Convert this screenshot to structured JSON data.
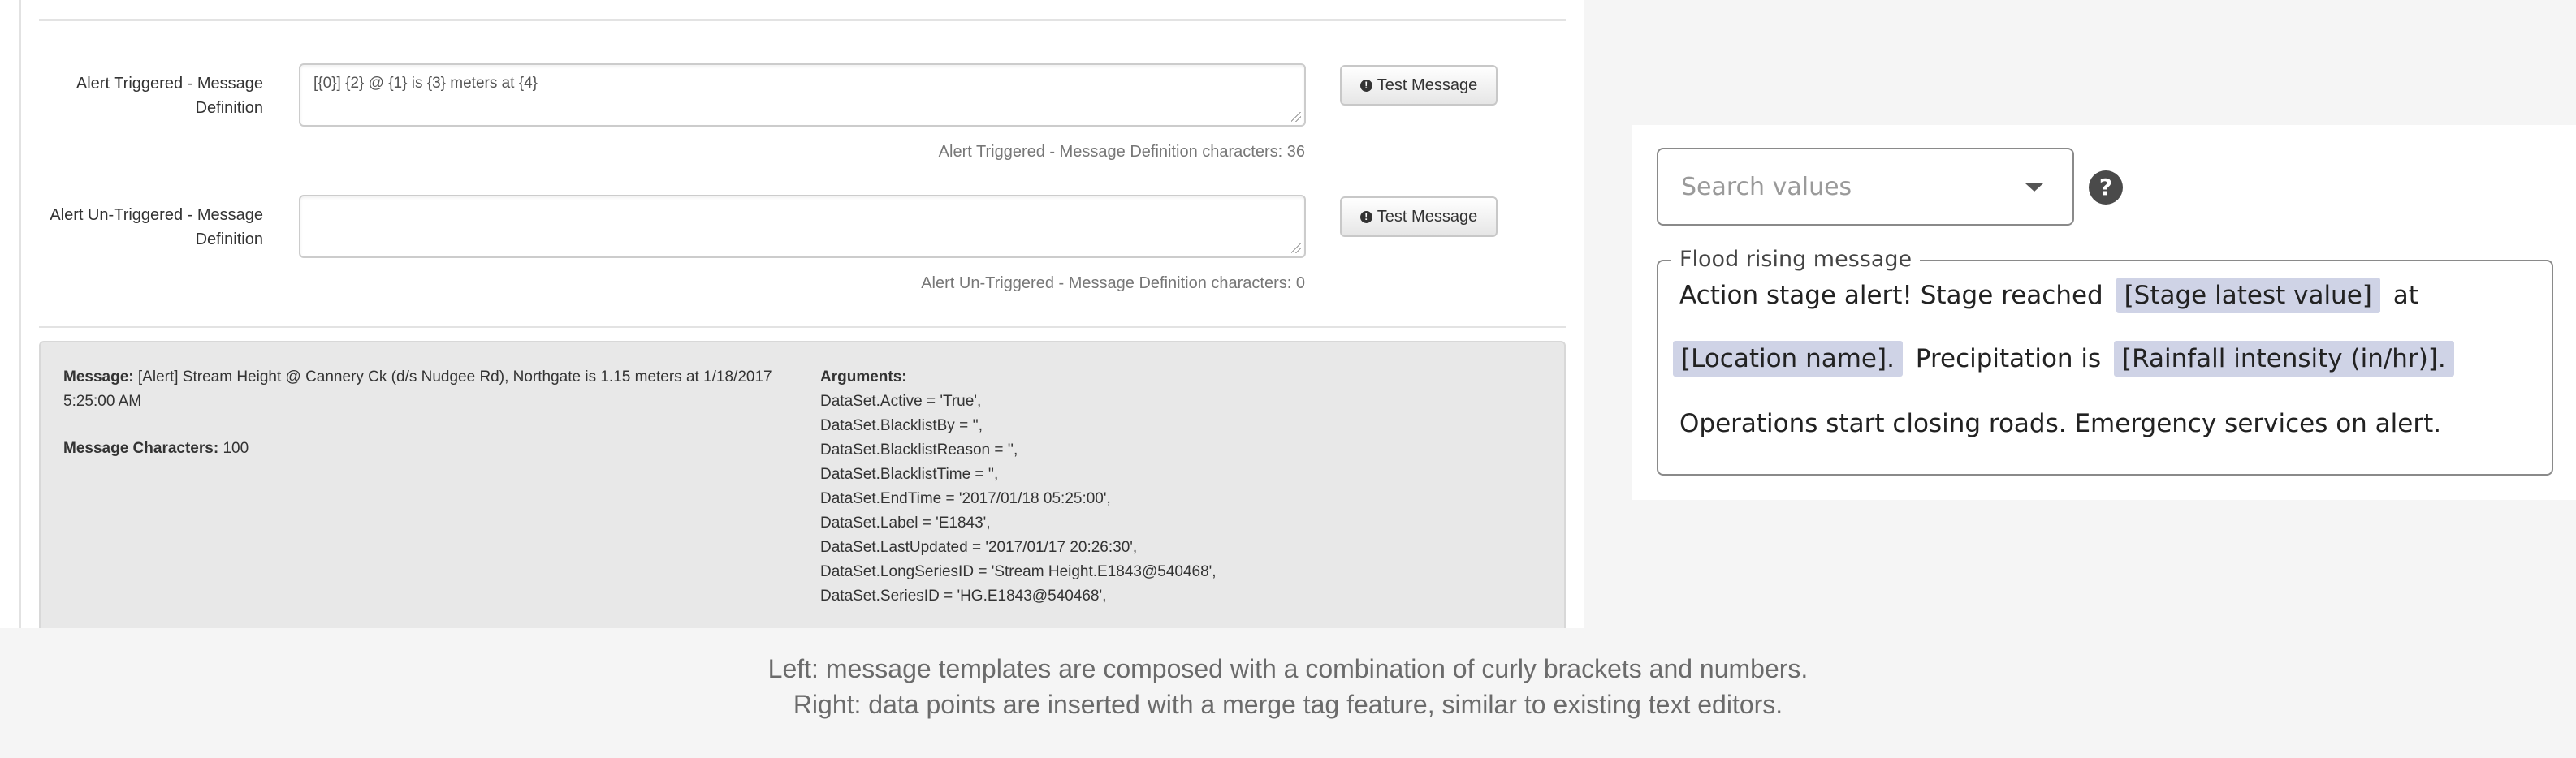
{
  "left": {
    "triggered": {
      "label": "Alert Triggered - Message Definition",
      "value": "[{0}] {2} @ {1} is {3} meters at {4}",
      "button": "Test Message",
      "char_count": "Alert Triggered - Message Definition characters: 36"
    },
    "untriggered": {
      "label": "Alert Un-Triggered - Message Definition",
      "value": "",
      "button": "Test Message",
      "char_count": "Alert Un-Triggered - Message Definition characters: 0"
    },
    "preview": {
      "message_label": "Message:",
      "message_text": "[Alert] Stream Height @ Cannery Ck (d/s Nudgee Rd), Northgate is 1.15 meters at 1/18/2017 5:25:00 AM",
      "chars_label": "Message Characters:",
      "chars_value": "100",
      "args_label": "Arguments:",
      "arguments": [
        "DataSet.Active = 'True',",
        "DataSet.BlacklistBy = '',",
        "DataSet.BlacklistReason = '',",
        "DataSet.BlacklistTime = '',",
        "DataSet.EndTime = '2017/01/18 05:25:00',",
        "DataSet.Label = 'E1843',",
        "DataSet.LastUpdated = '2017/01/17 20:26:30',",
        "DataSet.LongSeriesID = 'Stream Height.E1843@540468',",
        "DataSet.SeriesID = 'HG.E1843@540468',"
      ]
    }
  },
  "right": {
    "search_placeholder": "Search values",
    "help_glyph": "?",
    "legend": "Flood rising message",
    "line1_text": "Action stage alert! Stage reached",
    "line1_tag": "[Stage latest value]",
    "line1_after": "at",
    "line2_tag": "[Location name].",
    "line2_text": "Precipitation is",
    "line2_tag2": "[Rainfall intensity (in/hr)].",
    "line3_text": "Operations start closing roads. Emergency services on alert."
  },
  "caption": {
    "line1": "Left: message templates are composed with a combination of curly brackets and numbers.",
    "line2": "Right: data points are inserted with a merge tag feature, similar to existing text editors."
  },
  "icons": {
    "test_button_icon": "exclamation-circle-icon",
    "dropdown_icon": "chevron-down-icon",
    "help_icon": "question-circle-icon"
  }
}
